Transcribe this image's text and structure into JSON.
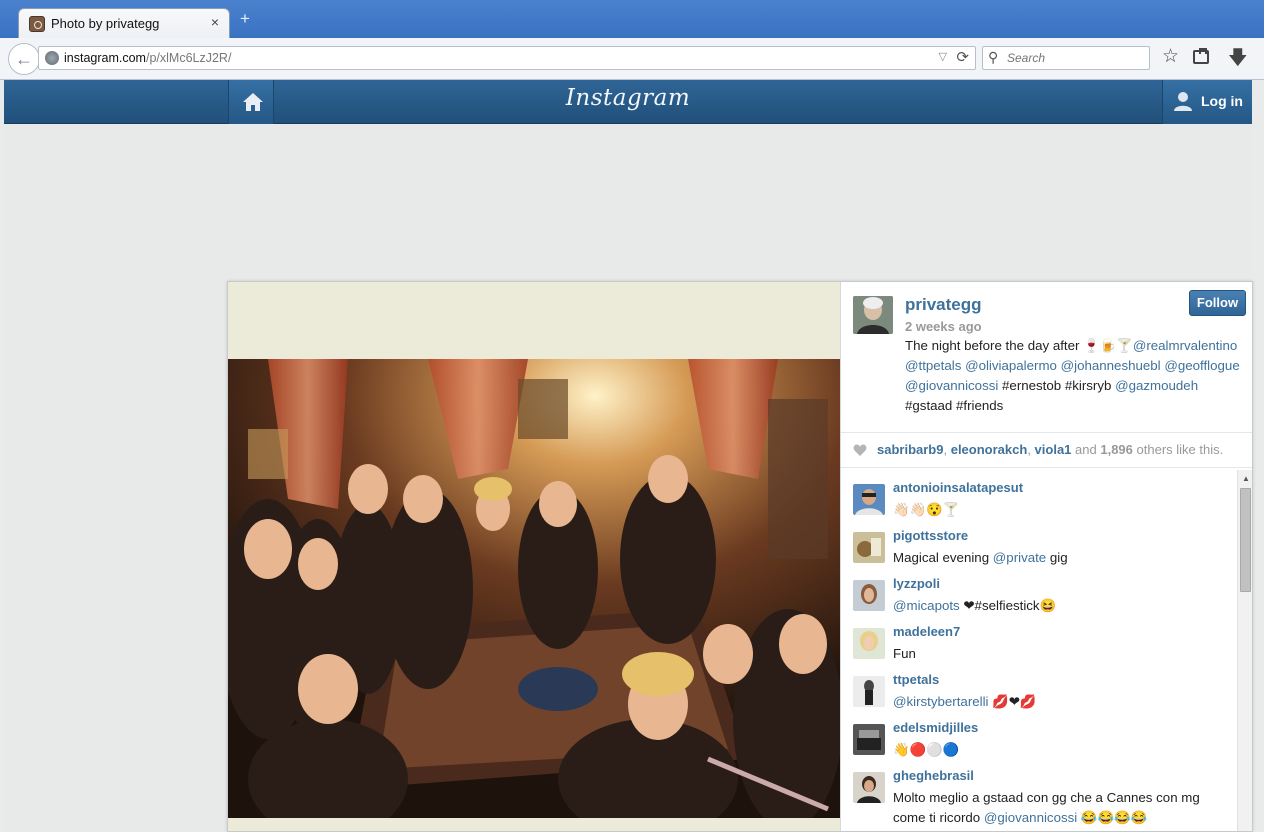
{
  "browser": {
    "tab_title": "Photo by privategg",
    "new_tab": "+",
    "tab_close": "×",
    "url_host": "instagram.com",
    "url_path": "/p/xlMc6LzJ2R/",
    "search_placeholder": "Search"
  },
  "header": {
    "logo": "Instagram",
    "login_label": "Log in"
  },
  "post": {
    "owner": "privategg",
    "time_ago": "2 weeks ago",
    "follow_label": "Follow",
    "caption": {
      "line1_text": "The night before the day after ",
      "line1_mention": "@realmrvalentino",
      "line2": [
        "@ttpetals",
        "@oliviapalermo",
        "@johanneshuebl",
        "@geofflogue"
      ],
      "line3_mention_a": "@giovannicossi",
      "line3_tags": " #ernestob #kirsryb ",
      "line3_mention_b": "@gazmoudeh",
      "line4": "#gstaad #friends"
    },
    "likes": {
      "users": [
        "sabribarb9",
        "eleonorakch",
        "viola1"
      ],
      "and": "and",
      "count": "1,896",
      "suffix": "others like this."
    }
  },
  "comments": [
    {
      "user": "antonioinsalatapesut",
      "text": "👋🏻👋🏻😯🍸"
    },
    {
      "user": "pigottsstore",
      "text_a": "Magical evening ",
      "mention": "@private",
      "text_b": " gig"
    },
    {
      "user": "lyzzpoli",
      "mention": "@micapots",
      "text_b": " ❤#selfiestick😆"
    },
    {
      "user": "madeleen7",
      "text": "Fun"
    },
    {
      "user": "ttpetals",
      "mention": "@kirstybertarelli",
      "text_b": " 💋❤💋"
    },
    {
      "user": "edelsmidjilles",
      "text": "👋🔴⚪🔵"
    },
    {
      "user": "gheghebrasil",
      "text_a": "Molto meglio a gstaad con gg che a Cannes con mg",
      "text_b": "come ti ricordo ",
      "mention": "@giovannicossi",
      "text_c": " 😂😂😂😂"
    }
  ],
  "colors": {
    "link": "#3f729b",
    "header": "#2f6596"
  }
}
